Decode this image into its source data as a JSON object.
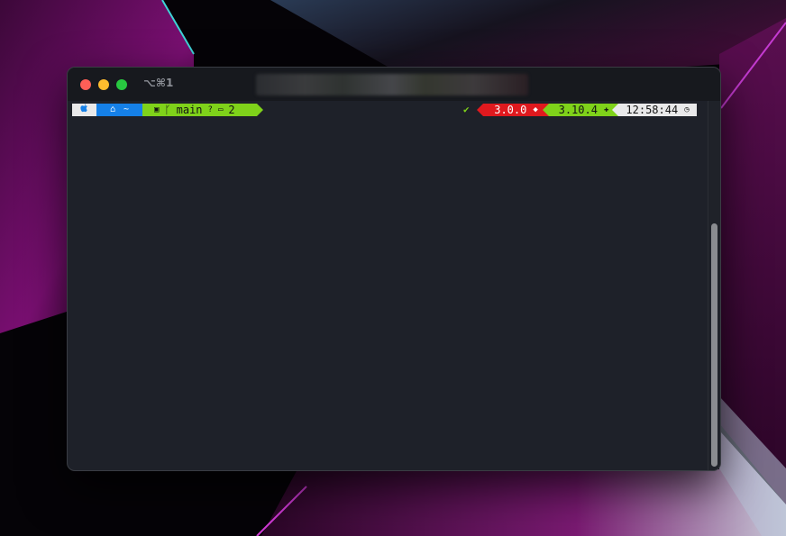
{
  "window": {
    "tab_shortcut": "⌥⌘1"
  },
  "prompt": {
    "left": {
      "apple_icon": "apple-icon",
      "home_icon": "home-icon",
      "cwd": "~",
      "git_icon": "git-icon",
      "branch_symbol": "ᚴ",
      "branch": "main",
      "untracked_symbol": "?",
      "stash_icon": "stash-icon",
      "stash_count": "2"
    },
    "right": {
      "status_symbol": "✔",
      "ruby_version": "3.0.0",
      "ruby_icon": "ruby-icon",
      "python_version": "3.10.4",
      "python_icon": "python-icon",
      "time": "12:58:44",
      "clock_icon": "clock-icon"
    }
  },
  "colors": {
    "terminal_bg": "#1e2129",
    "apple_segment": "#e9e9ea",
    "home_segment": "#1580e8",
    "git_segment": "#7fd21a",
    "ruby_segment": "#e0191e",
    "python_segment": "#7fd21a",
    "time_segment": "#e9e9ea"
  }
}
